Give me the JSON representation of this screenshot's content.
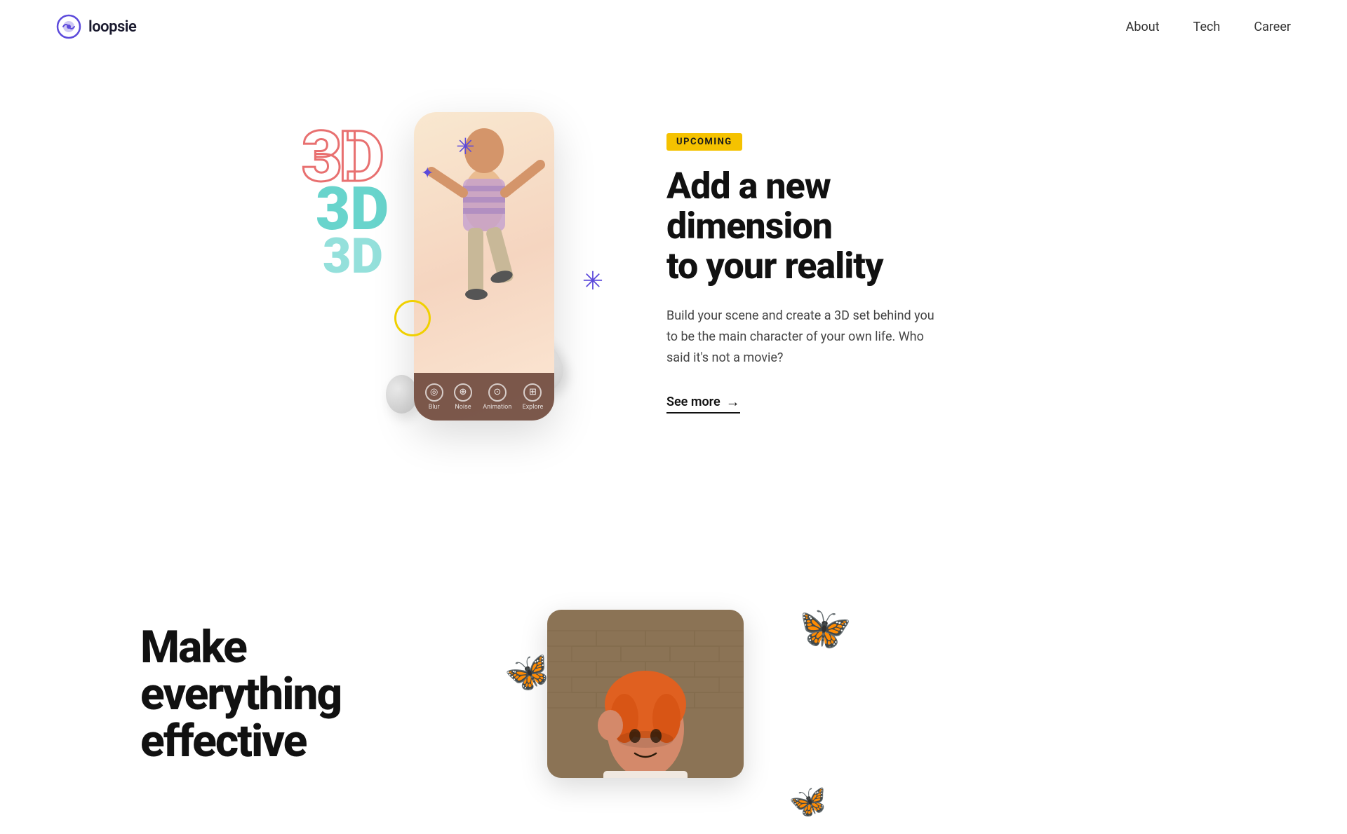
{
  "nav": {
    "logo_text": "loopsie",
    "links": [
      {
        "id": "about",
        "label": "About"
      },
      {
        "id": "tech",
        "label": "Tech"
      },
      {
        "id": "career",
        "label": "Career"
      }
    ]
  },
  "section_3d": {
    "badge": "UPCOMING",
    "heading_line1": "Add a new dimension",
    "heading_line2": "to your reality",
    "description": "Build your scene and create a 3D set behind you to be the main character of your own life. Who said it's not a movie?",
    "see_more": "See more",
    "phone_bar": {
      "items": [
        {
          "label": "Blur",
          "symbol": "◎"
        },
        {
          "label": "Noise",
          "symbol": "⊕"
        },
        {
          "label": "Animation",
          "symbol": "⊙"
        },
        {
          "label": "Explore",
          "symbol": "⊞"
        }
      ]
    }
  },
  "section_butterflies": {
    "heading_line1": "Make everything",
    "heading_line2": "effective"
  },
  "decorators": {
    "number_bg": "3D",
    "number_teal": "3D",
    "number_teal2": "3D",
    "star": "✳",
    "asterisk": "*",
    "butterfly_emoji": "🦋"
  }
}
